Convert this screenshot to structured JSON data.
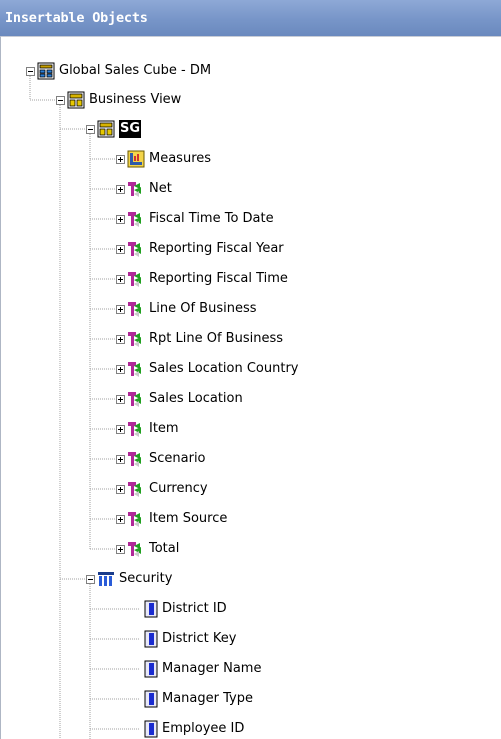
{
  "panel": {
    "title": "Insertable Objects"
  },
  "tree": {
    "root": {
      "label": "Global Sales Cube - DM",
      "icon": "cube-icon",
      "expanded": true
    },
    "business_view": {
      "label": "Business View",
      "icon": "business-view-icon",
      "expanded": true
    },
    "sg": {
      "label": "SG",
      "icon": "business-view-icon",
      "expanded": true,
      "selected": true
    },
    "sg_children": [
      {
        "label": "Measures",
        "icon": "measures-icon",
        "expanded": false
      },
      {
        "label": "Net",
        "icon": "dimension-icon",
        "expanded": false
      },
      {
        "label": "Fiscal Time To Date",
        "icon": "dimension-icon",
        "expanded": false
      },
      {
        "label": "Reporting Fiscal Year",
        "icon": "dimension-icon",
        "expanded": false
      },
      {
        "label": "Reporting Fiscal Time",
        "icon": "dimension-icon",
        "expanded": false
      },
      {
        "label": "Line Of Business",
        "icon": "dimension-icon",
        "expanded": false
      },
      {
        "label": "Rpt Line Of Business",
        "icon": "dimension-icon",
        "expanded": false
      },
      {
        "label": "Sales Location Country",
        "icon": "dimension-icon",
        "expanded": false
      },
      {
        "label": "Sales Location",
        "icon": "dimension-icon",
        "expanded": false
      },
      {
        "label": "Item",
        "icon": "dimension-icon",
        "expanded": false
      },
      {
        "label": "Scenario",
        "icon": "dimension-icon",
        "expanded": false
      },
      {
        "label": "Currency",
        "icon": "dimension-icon",
        "expanded": false
      },
      {
        "label": "Item Source",
        "icon": "dimension-icon",
        "expanded": false
      },
      {
        "label": "Total",
        "icon": "dimension-icon",
        "expanded": false
      }
    ],
    "security": {
      "label": "Security",
      "icon": "query-subject-icon",
      "expanded": true
    },
    "security_children": [
      {
        "label": "District ID",
        "icon": "query-item-icon"
      },
      {
        "label": "District Key",
        "icon": "query-item-icon"
      },
      {
        "label": "Manager Name",
        "icon": "query-item-icon"
      },
      {
        "label": "Manager Type",
        "icon": "query-item-icon"
      },
      {
        "label": "Employee ID",
        "icon": "query-item-icon"
      }
    ]
  },
  "colors": {
    "header_bg": "#7795c8",
    "header_text": "#ffffff",
    "selection_bg": "#000000",
    "selection_text": "#ffffff",
    "tree_line": "#a0a0a0"
  }
}
